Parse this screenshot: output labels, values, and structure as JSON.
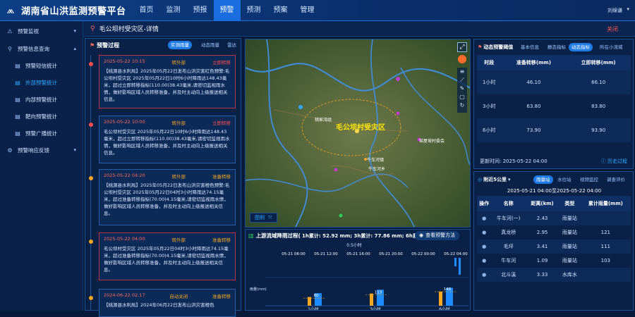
{
  "app": {
    "title": "湖南省山洪监测预警平台",
    "user": "刘绵谦"
  },
  "nav": [
    "首页",
    "监测",
    "预报",
    "预警",
    "预测",
    "预案",
    "管理"
  ],
  "nav_active": 3,
  "sidebar": {
    "items": [
      {
        "label": "预警监视",
        "level": 0,
        "icon": "bell-icon"
      },
      {
        "label": "预警信息查询",
        "level": 0,
        "icon": "search-icon"
      },
      {
        "label": "预警短信统计",
        "level": 1,
        "icon": "doc-icon"
      },
      {
        "label": "外部预警统计",
        "level": 1,
        "icon": "doc-icon",
        "active": true
      },
      {
        "label": "内部预警统计",
        "level": 1,
        "icon": "doc-icon"
      },
      {
        "label": "靶向预警统计",
        "level": 1,
        "icon": "doc-icon"
      },
      {
        "label": "预警广播统计",
        "level": 1,
        "icon": "doc-icon"
      },
      {
        "label": "预警响应反馈",
        "level": 0,
        "icon": "feedback-icon"
      }
    ]
  },
  "page": {
    "title": "毛公坝村受灾区-详情",
    "close": "关闭"
  },
  "process": {
    "title": "预警过程",
    "tabs": [
      "实测雨量",
      "动态雨量",
      "雷达"
    ],
    "cards": [
      {
        "date": "2025-05-22 10:15",
        "dept": "转外部",
        "status": "立即转移",
        "status_color": "red",
        "border": "red",
        "text": "【桃源县水利局】2025年05月22日发布山洪灾害红色预警:毛公坝村受灾区 2025年05月22日10时6小时降雨达148.43毫米，超过立即转移指标(110.00)38.43毫米,请密切监视雨水情，做好影响区域人员转移准备，并及时主动向上级报送相关信息。"
      },
      {
        "date": "2025-05-22 10:00",
        "dept": "转外部",
        "status": "立即转移",
        "status_color": "red",
        "border": "blue",
        "text": "毛公坝村受灾区 2025年05月22日10时6小时降雨达148.43毫米，超过立即转移指标(110.00)38.43毫米,请密切监视雨水情，做好影响区域人员转移准备，并及时主动向上级报送相关信息。"
      },
      {
        "date": "2025-05-22 04:20",
        "dept": "转外部",
        "status": "准备转移",
        "status_color": "orange",
        "border": "blue",
        "text": "【桃源县水利局】2025年05月22日发布山洪灾害橙色预警:毛公坝村受灾区 2025年05月22日04时3小时降雨达74.15毫米，超过准备转移指标(70.00)4.15毫米,请密切监视雨水情，做好影响区域人员转移准备，并及时主动向上级报送相关信息。"
      },
      {
        "date": "2025-05-22 04:00",
        "dept": "转外部",
        "status": "准备转移",
        "status_color": "orange",
        "border": "red",
        "text": "毛公坝村受灾区 2025年05月22日04时3小时降雨达74.15毫米，超过准备转移指标(70.00)4.15毫米,请密切监视雨水情，做好影响区域人员转移准备，并及时主动向上级报送相关信息。"
      },
      {
        "date": "2024-06-22 02:17",
        "dept": "自动关闭",
        "status": "准备转移",
        "status_color": "orange",
        "border": "blue",
        "text": "【桃源县水利局】2024年06月22日发布山洪灾害橙色"
      }
    ]
  },
  "map": {
    "main_label": "毛公坝村受灾区",
    "places": [
      "桃家湾组",
      "窑屋坡村委会",
      "牛车河镇",
      "牛车河乡"
    ],
    "legend": "图例"
  },
  "rain_chart": {
    "title": "上游流域降雨过程(",
    "stats": "1h累计: 52.92 mm;  3h累计: 77.86 mm;  6h累",
    "method_btn": "查看预警方法",
    "unit": "0.5小时",
    "time_labels": [
      "05-21 08:00",
      "05-21 12:00",
      "05-21 16:00",
      "05-21 20:00",
      "05-22 00:00",
      "05-22 04:00"
    ],
    "ylabel": "雨量(mm)"
  },
  "chart_data": {
    "type": "bar",
    "categories": [
      "1小时",
      "3小时",
      "6小时"
    ],
    "series": [
      {
        "name": "",
        "values": [
          46,
          64,
          74
        ]
      },
      {
        "name": "",
        "values": [
          66,
          84,
          94
        ]
      }
    ],
    "markers": [
      80,
      113,
      148
    ],
    "colors": [
      "#f5a623",
      "#1e8bff"
    ]
  },
  "threshold": {
    "title": "动态预警阈值",
    "tabs": [
      "基本信息",
      "静态指标",
      "动态指标",
      "所在小流域"
    ],
    "active_tab": 2,
    "headers": [
      "时段",
      "准备转移(mm)",
      "立即转移(mm)"
    ],
    "rows": [
      [
        "1小时",
        "46.10",
        "66.10"
      ],
      [
        "3小时",
        "63.80",
        "83.80"
      ],
      [
        "6小时",
        "73.90",
        "93.90"
      ]
    ],
    "update_label": "更新时间: 2025-05-22 04:00",
    "history": "历史过程"
  },
  "nearby": {
    "title": "附近5公里",
    "tabs": [
      "雨量站",
      "水位站",
      "视频监控",
      "调查评价"
    ],
    "time_range": "2025-05-21 04:00至2025-05-22 04:00",
    "headers": [
      "操作",
      "名称",
      "距离(km)",
      "类型",
      "累计雨量(mm)"
    ],
    "rows": [
      [
        "●",
        "牛车河(一)",
        "2.43",
        "雨量站",
        ""
      ],
      [
        "●",
        "真龙桥",
        "2.95",
        "雨量站",
        "121"
      ],
      [
        "●",
        "毛坪",
        "3.41",
        "雨量站",
        "111"
      ],
      [
        "●",
        "牛车河",
        "1.09",
        "雨量站",
        "103"
      ],
      [
        "●",
        "北斗溪",
        "3.33",
        "水库水",
        ""
      ]
    ]
  }
}
